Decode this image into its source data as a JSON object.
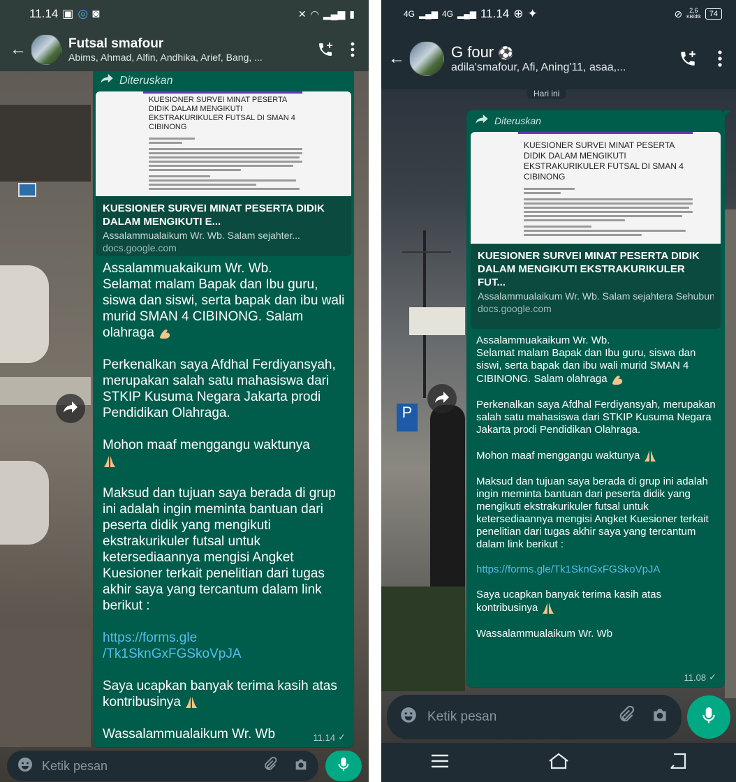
{
  "left": {
    "status": {
      "time": "11.14"
    },
    "header": {
      "title": "Futsal smafour",
      "members": "Abims, Ahmad, Alfin, Andhika, Arief, Bang, ..."
    },
    "forwarded_label": "Diteruskan",
    "card": {
      "doc_heading": "KUESIONER SURVEI MINAT PESERTA DIDIK DALAM MENGIKUTI EKSTRAKURIKULER FUTSAL DI SMAN 4 CIBINONG",
      "title": "KUESIONER SURVEI MINAT PESERTA DIDIK DALAM MENGIKUTI E...",
      "description": "Assalammualaikum Wr. Wb. Salam sejahter...",
      "domain": "docs.google.com"
    },
    "message": {
      "p1": "Assalammuakaikum Wr. Wb.\nSelamat malam Bapak dan Ibu guru, siswa dan siswi, serta bapak dan ibu wali murid SMAN 4 CIBINONG. Salam olahraga",
      "p2": "Perkenalkan saya Afdhal Ferdiyansyah, merupakan salah satu mahasiswa dari STKIP Kusuma Negara Jakarta prodi Pendidikan Olahraga.",
      "p3": "Mohon maaf menggangu waktunya",
      "p4": "Maksud dan tujuan saya berada di grup ini adalah ingin meminta bantuan dari peserta didik yang mengikuti ekstrakurikuler futsal untuk ketersediaannya mengisi Angket Kuesioner terkait penelitian dari tugas akhir saya yang tercantum dalam link berikut :",
      "link": "https://forms.gle\n/Tk1SknGxFGSkoVpJA",
      "p5": "Saya ucapkan banyak terima kasih atas kontribusinya",
      "p6": "Wassalammualaikum Wr. Wb",
      "time": "11.14"
    },
    "input": {
      "placeholder": "Ketik pesan"
    }
  },
  "right": {
    "status": {
      "time": "11.14",
      "net_left": "4G",
      "speed": "2,6",
      "speed_unit": "KB/dtk",
      "battery": "74"
    },
    "header": {
      "title": "G four",
      "members": "adila'smafour, Afi, Aning'11, asaa,..."
    },
    "date_chip": "Hari ini",
    "forwarded_label": "Diteruskan",
    "card": {
      "doc_heading": "KUESIONER SURVEI MINAT PESERTA DIDIK DALAM MENGIKUTI EKSTRAKURIKULER FUTSAL DI SMAN 4 CIBINONG",
      "title": "KUESIONER SURVEI MINAT PESERTA DIDIK DALAM MENGIKUTI EKSTRAKURIKULER FUT...",
      "description": "Assalammualaikum Wr. Wb. Salam sejahtera Sehubun...",
      "domain": "docs.google.com"
    },
    "message": {
      "p1": "Assalammuakaikum Wr. Wb.\nSelamat malam Bapak dan Ibu guru, siswa dan siswi, serta bapak dan ibu wali murid SMAN 4 CIBINONG. Salam olahraga",
      "p2": "Perkenalkan saya Afdhal Ferdiyansyah, merupakan salah satu mahasiswa dari STKIP Kusuma Negara Jakarta prodi Pendidikan Olahraga.",
      "p3": "Mohon maaf menggangu waktunya",
      "p4": "Maksud dan tujuan saya berada di grup ini adalah ingin meminta bantuan dari peserta didik yang mengikuti ekstrakurikuler futsal untuk ketersediaannya mengisi Angket Kuesioner terkait penelitian dari tugas akhir saya yang tercantum dalam link berikut :",
      "link": "https://forms.gle/Tk1SknGxFGSkoVpJA",
      "p5": "Saya ucapkan banyak terima kasih atas kontribusinya",
      "p6": "Wassalammualaikum Wr. Wb",
      "time": "11.08"
    },
    "input": {
      "placeholder": "Ketik pesan"
    }
  },
  "colors": {
    "bubble": "#005c4b",
    "link": "#53bdeb",
    "accent": "#00a884",
    "header": "#1f2c34"
  },
  "icons": [
    "back-arrow-icon",
    "add-call-icon",
    "more-vertical-icon",
    "forward-icon",
    "emoji-icon",
    "attach-icon",
    "camera-icon",
    "mic-icon",
    "menu-icon",
    "home-icon",
    "back-nav-icon"
  ]
}
